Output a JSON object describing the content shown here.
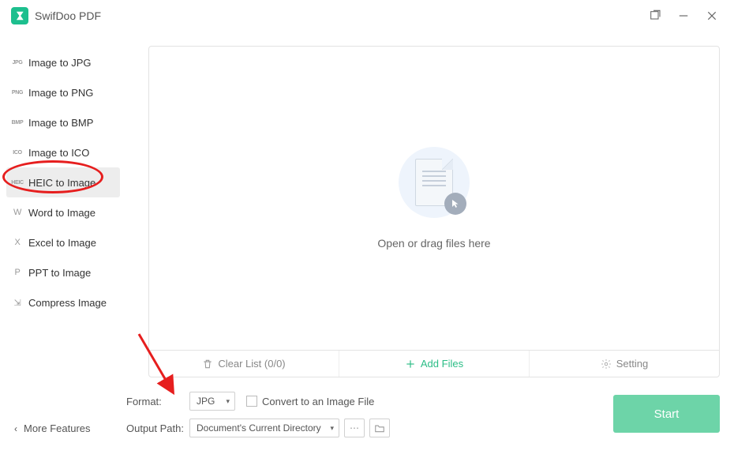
{
  "app": {
    "title": "SwifDoo PDF"
  },
  "sidebar": {
    "items": [
      {
        "badge": "JPG",
        "label": "Image to JPG"
      },
      {
        "badge": "PNG",
        "label": "Image to PNG"
      },
      {
        "badge": "BMP",
        "label": "Image to BMP"
      },
      {
        "badge": "ICO",
        "label": "Image to ICO"
      },
      {
        "badge": "HEIC",
        "label": "HEIC to Image"
      },
      {
        "badge": "W",
        "label": "Word to Image"
      },
      {
        "badge": "X",
        "label": "Excel to Image"
      },
      {
        "badge": "P",
        "label": "PPT to Image"
      },
      {
        "badge": "⇲",
        "label": "Compress Image"
      }
    ],
    "more": "More Features"
  },
  "drop": {
    "text": "Open or drag files here",
    "toolbar": {
      "clear": "Clear List (0/0)",
      "add": "Add Files",
      "setting": "Setting"
    }
  },
  "controls": {
    "format_label": "Format:",
    "format_value": "JPG",
    "convert_checkbox": "Convert to an Image File",
    "output_label": "Output Path:",
    "output_value": "Document's Current Directory",
    "start": "Start"
  }
}
